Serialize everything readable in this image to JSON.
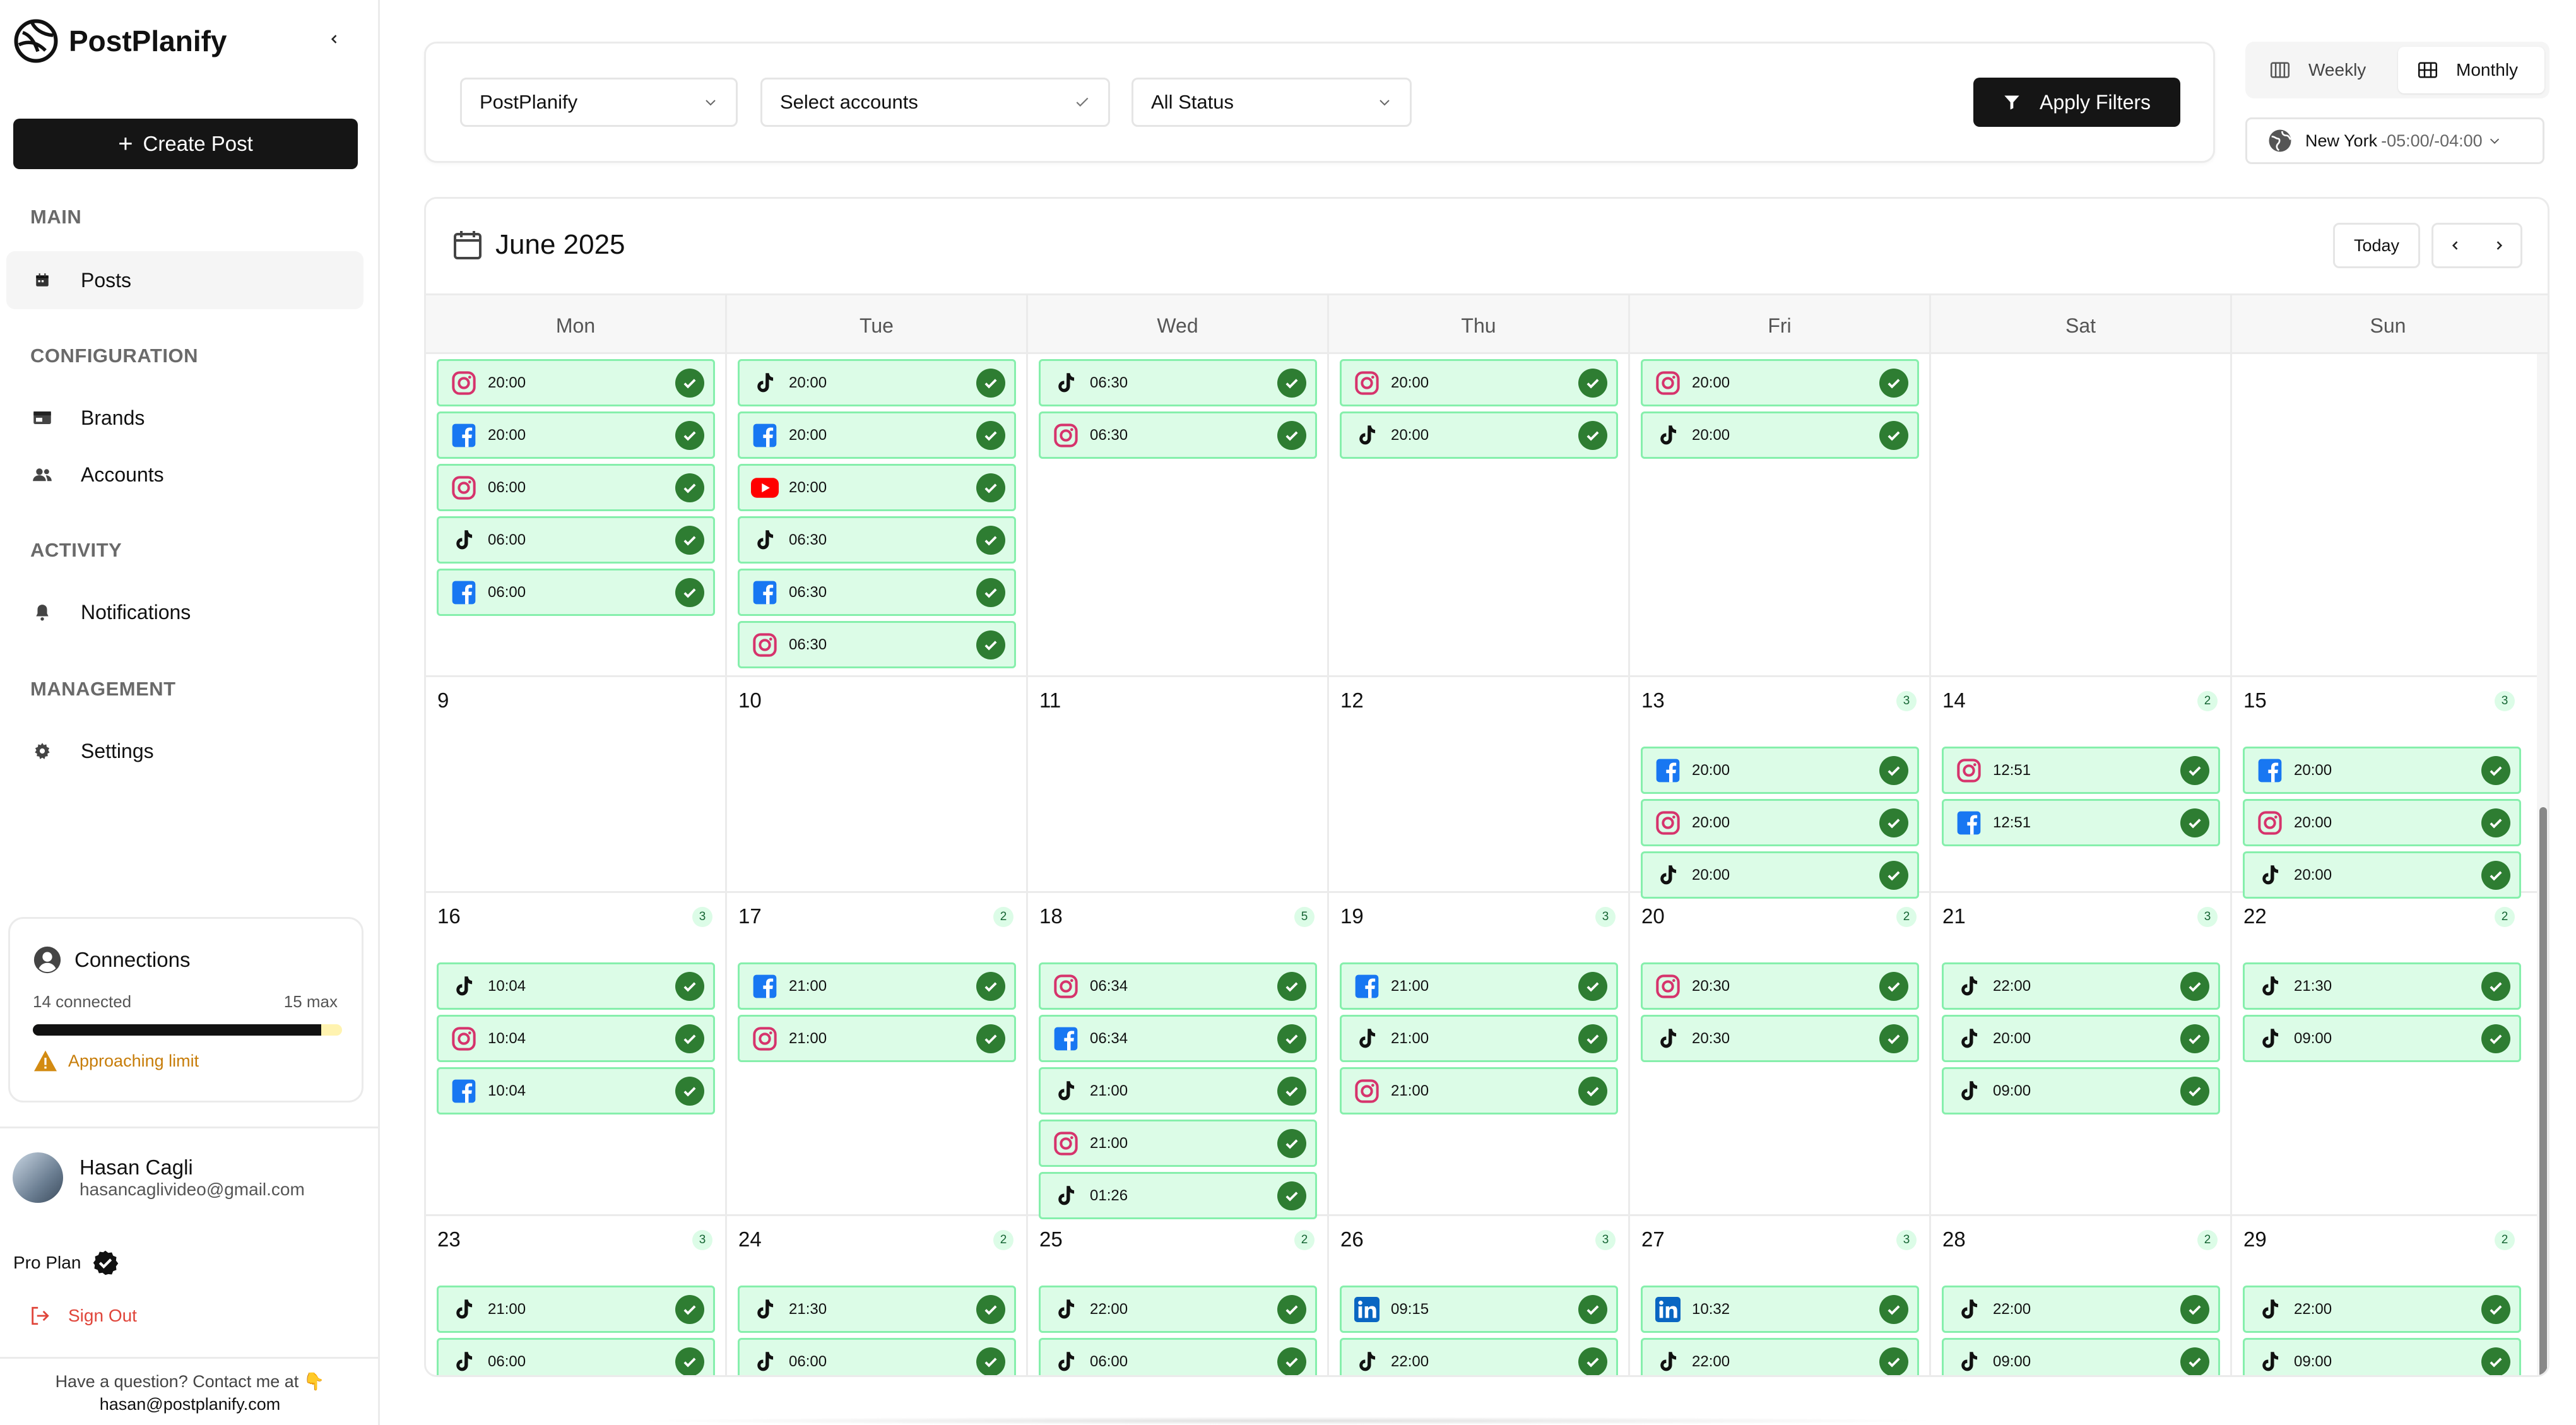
{
  "app": {
    "name": "PostPlanify"
  },
  "sidebar": {
    "create_label": "Create Post",
    "sections": [
      {
        "title": "MAIN",
        "items": [
          {
            "label": "Posts",
            "icon": "calendar-icon",
            "active": true
          }
        ]
      },
      {
        "title": "CONFIGURATION",
        "items": [
          {
            "label": "Brands",
            "icon": "brand-icon"
          },
          {
            "label": "Accounts",
            "icon": "users-icon"
          }
        ]
      },
      {
        "title": "ACTIVITY",
        "items": [
          {
            "label": "Notifications",
            "icon": "bell-icon"
          }
        ]
      },
      {
        "title": "MANAGEMENT",
        "items": [
          {
            "label": "Settings",
            "icon": "gear-icon"
          }
        ]
      }
    ],
    "connections": {
      "title": "Connections",
      "count_text": "14 connected",
      "max_text": "15 max",
      "connected": 14,
      "max": 15,
      "warning": "Approaching limit"
    },
    "user": {
      "name": "Hasan Cagli",
      "email": "hasancaglivideo@gmail.com"
    },
    "plan": "Pro Plan",
    "sign_out": "Sign Out",
    "help_text": "Have a question? Contact me at 👇",
    "help_email": "hasan@postplanify.com"
  },
  "filters": {
    "brand": "PostPlanify",
    "accounts": "Select accounts",
    "status": "All Status",
    "apply_label": "Apply Filters"
  },
  "view": {
    "weekly": "Weekly",
    "monthly": "Monthly",
    "active": "monthly"
  },
  "timezone": {
    "name": "New York",
    "offset": "-05:00/-04:00"
  },
  "calendar": {
    "title": "June 2025",
    "today_label": "Today",
    "weekdays": [
      "Mon",
      "Tue",
      "Wed",
      "Thu",
      "Fri",
      "Sat",
      "Sun"
    ],
    "weeks": [
      {
        "days": [
          {
            "day": "",
            "posts": [
              {
                "p": "instagram",
                "t": "20:00"
              },
              {
                "p": "facebook",
                "t": "20:00"
              },
              {
                "p": "instagram",
                "t": "06:00"
              },
              {
                "p": "tiktok",
                "t": "06:00"
              },
              {
                "p": "facebook",
                "t": "06:00"
              }
            ]
          },
          {
            "day": "",
            "posts": [
              {
                "p": "tiktok",
                "t": "20:00"
              },
              {
                "p": "facebook",
                "t": "20:00"
              },
              {
                "p": "youtube",
                "t": "20:00"
              },
              {
                "p": "tiktok",
                "t": "06:30"
              },
              {
                "p": "facebook",
                "t": "06:30"
              },
              {
                "p": "instagram",
                "t": "06:30"
              }
            ]
          },
          {
            "day": "",
            "posts": [
              {
                "p": "tiktok",
                "t": "06:30"
              },
              {
                "p": "instagram",
                "t": "06:30"
              }
            ]
          },
          {
            "day": "",
            "posts": [
              {
                "p": "instagram",
                "t": "20:00"
              },
              {
                "p": "tiktok",
                "t": "20:00"
              }
            ]
          },
          {
            "day": "",
            "posts": [
              {
                "p": "instagram",
                "t": "20:00"
              },
              {
                "p": "tiktok",
                "t": "20:00"
              }
            ]
          },
          {
            "day": "",
            "posts": []
          },
          {
            "day": "",
            "posts": []
          }
        ]
      },
      {
        "days": [
          {
            "day": "9",
            "posts": []
          },
          {
            "day": "10",
            "posts": []
          },
          {
            "day": "11",
            "posts": []
          },
          {
            "day": "12",
            "posts": []
          },
          {
            "day": "13",
            "count": "3",
            "posts": [
              {
                "p": "facebook",
                "t": "20:00"
              },
              {
                "p": "instagram",
                "t": "20:00"
              },
              {
                "p": "tiktok",
                "t": "20:00"
              }
            ]
          },
          {
            "day": "14",
            "count": "2",
            "posts": [
              {
                "p": "instagram",
                "t": "12:51"
              },
              {
                "p": "facebook",
                "t": "12:51"
              }
            ]
          },
          {
            "day": "15",
            "count": "3",
            "posts": [
              {
                "p": "facebook",
                "t": "20:00"
              },
              {
                "p": "instagram",
                "t": "20:00"
              },
              {
                "p": "tiktok",
                "t": "20:00"
              }
            ]
          }
        ]
      },
      {
        "days": [
          {
            "day": "16",
            "count": "3",
            "posts": [
              {
                "p": "tiktok",
                "t": "10:04"
              },
              {
                "p": "instagram",
                "t": "10:04"
              },
              {
                "p": "facebook",
                "t": "10:04"
              }
            ]
          },
          {
            "day": "17",
            "count": "2",
            "posts": [
              {
                "p": "facebook",
                "t": "21:00"
              },
              {
                "p": "instagram",
                "t": "21:00"
              }
            ]
          },
          {
            "day": "18",
            "count": "5",
            "posts": [
              {
                "p": "instagram",
                "t": "06:34"
              },
              {
                "p": "facebook",
                "t": "06:34"
              },
              {
                "p": "tiktok",
                "t": "21:00"
              },
              {
                "p": "instagram",
                "t": "21:00"
              },
              {
                "p": "tiktok",
                "t": "01:26"
              }
            ]
          },
          {
            "day": "19",
            "count": "3",
            "posts": [
              {
                "p": "facebook",
                "t": "21:00"
              },
              {
                "p": "tiktok",
                "t": "21:00"
              },
              {
                "p": "instagram",
                "t": "21:00"
              }
            ]
          },
          {
            "day": "20",
            "count": "2",
            "posts": [
              {
                "p": "instagram",
                "t": "20:30"
              },
              {
                "p": "tiktok",
                "t": "20:30"
              }
            ]
          },
          {
            "day": "21",
            "count": "3",
            "posts": [
              {
                "p": "tiktok",
                "t": "22:00"
              },
              {
                "p": "tiktok",
                "t": "20:00"
              },
              {
                "p": "tiktok",
                "t": "09:00"
              }
            ]
          },
          {
            "day": "22",
            "count": "2",
            "posts": [
              {
                "p": "tiktok",
                "t": "21:30"
              },
              {
                "p": "tiktok",
                "t": "09:00"
              }
            ]
          }
        ]
      },
      {
        "days": [
          {
            "day": "23",
            "count": "3",
            "posts": [
              {
                "p": "tiktok",
                "t": "21:00"
              },
              {
                "p": "tiktok",
                "t": "06:00"
              }
            ]
          },
          {
            "day": "24",
            "count": "2",
            "posts": [
              {
                "p": "tiktok",
                "t": "21:30"
              },
              {
                "p": "tiktok",
                "t": "06:00"
              }
            ]
          },
          {
            "day": "25",
            "count": "2",
            "posts": [
              {
                "p": "tiktok",
                "t": "22:00"
              },
              {
                "p": "tiktok",
                "t": "06:00"
              }
            ]
          },
          {
            "day": "26",
            "count": "3",
            "posts": [
              {
                "p": "linkedin",
                "t": "09:15"
              },
              {
                "p": "tiktok",
                "t": "22:00"
              }
            ]
          },
          {
            "day": "27",
            "count": "3",
            "posts": [
              {
                "p": "linkedin",
                "t": "10:32"
              },
              {
                "p": "tiktok",
                "t": "22:00"
              }
            ]
          },
          {
            "day": "28",
            "count": "2",
            "posts": [
              {
                "p": "tiktok",
                "t": "22:00"
              },
              {
                "p": "tiktok",
                "t": "09:00"
              }
            ]
          },
          {
            "day": "29",
            "count": "2",
            "posts": [
              {
                "p": "tiktok",
                "t": "22:00"
              },
              {
                "p": "tiktok",
                "t": "09:00"
              }
            ]
          }
        ]
      }
    ]
  },
  "colors": {
    "accent": "#151515",
    "post_bg": "#dcfce7",
    "post_border": "#86efac",
    "check": "#2e7d32",
    "instagram": "#d6336c",
    "facebook": "#1877f2",
    "youtube": "#ff0000",
    "linkedin": "#0a66c2",
    "tiktok": "#000000",
    "warning": "#c77d0a",
    "signout": "#e0453a"
  }
}
